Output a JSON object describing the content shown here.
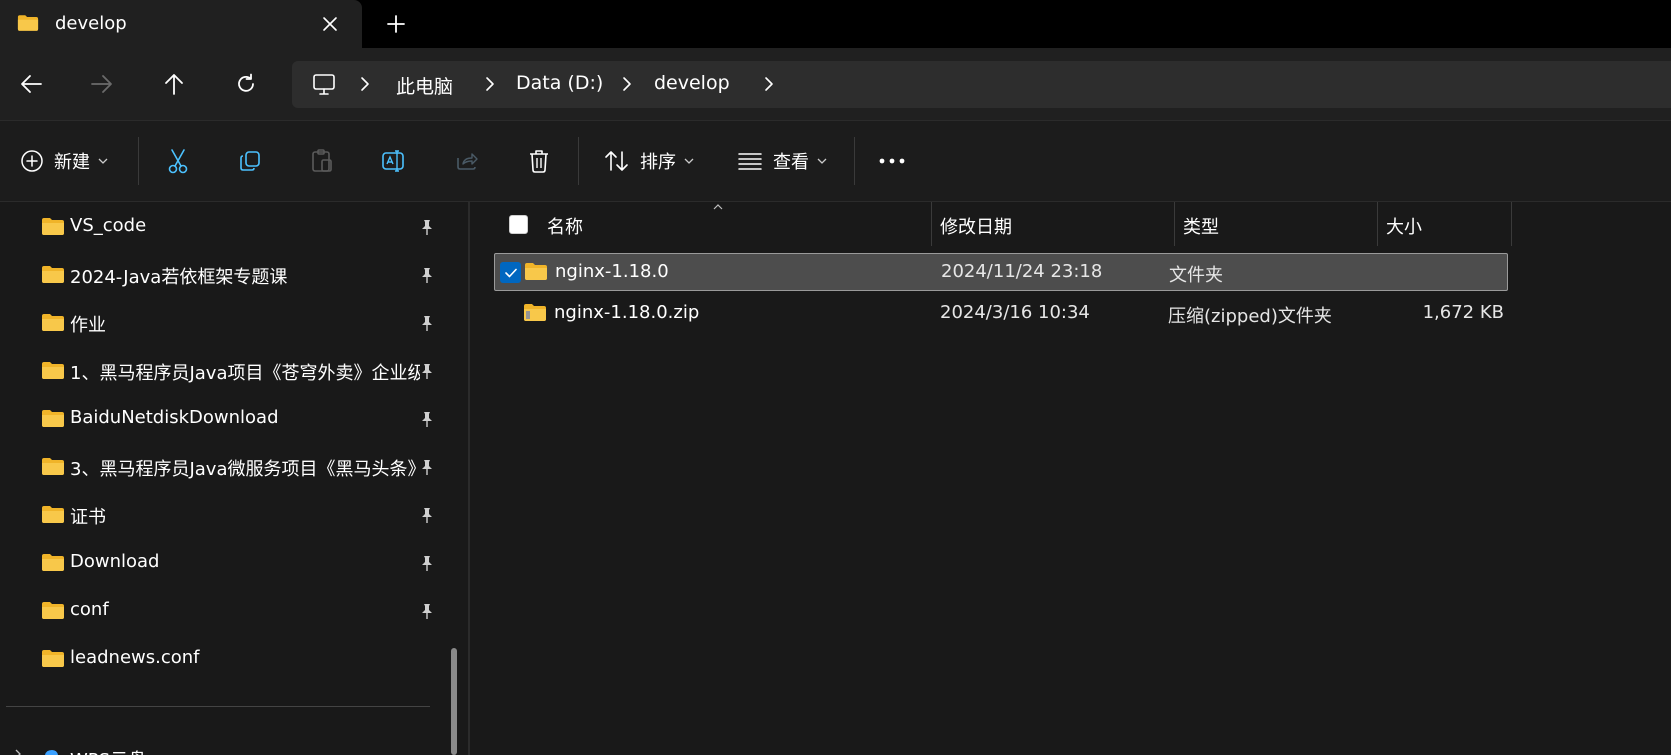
{
  "window": {
    "tab_title": "develop",
    "new_tab_label": "+"
  },
  "address": {
    "crumbs": [
      "此电脑",
      "Data (D:)",
      "develop"
    ]
  },
  "toolbar": {
    "new_label": "新建",
    "sort_label": "排序",
    "view_label": "查看",
    "more_label": "..."
  },
  "sidebar": {
    "items": [
      {
        "label": "VS_code",
        "pinned": true
      },
      {
        "label": "2024-Java若依框架专题课",
        "pinned": true
      },
      {
        "label": "作业",
        "pinned": true
      },
      {
        "label": "1、黑马程序员Java项目《苍穹外卖》企业级",
        "pinned": true
      },
      {
        "label": "BaiduNetdiskDownload",
        "pinned": true
      },
      {
        "label": "3、黑马程序员Java微服务项目《黑马头条》",
        "pinned": true
      },
      {
        "label": "证书",
        "pinned": true
      },
      {
        "label": "Download",
        "pinned": true
      },
      {
        "label": "conf",
        "pinned": true
      },
      {
        "label": "leadnews.conf",
        "pinned": false
      }
    ],
    "wps_label": "WPS云盘"
  },
  "list": {
    "columns": {
      "name": "名称",
      "date": "修改日期",
      "type": "类型",
      "size": "大小"
    },
    "rows": [
      {
        "name": "nginx-1.18.0",
        "date": "2024/11/24 23:18",
        "type": "文件夹",
        "size": "",
        "selected": true,
        "icon": "folder-icon"
      },
      {
        "name": "nginx-1.18.0.zip",
        "date": "2024/3/16 10:34",
        "type": "压缩(zipped)文件夹",
        "size": "1,672 KB",
        "selected": false,
        "icon": "zip-folder-icon"
      }
    ]
  },
  "colors": {
    "accent": "#0067c0",
    "folder": "#f8c84a",
    "background": "#191919",
    "selection": "#4d4d4d"
  }
}
